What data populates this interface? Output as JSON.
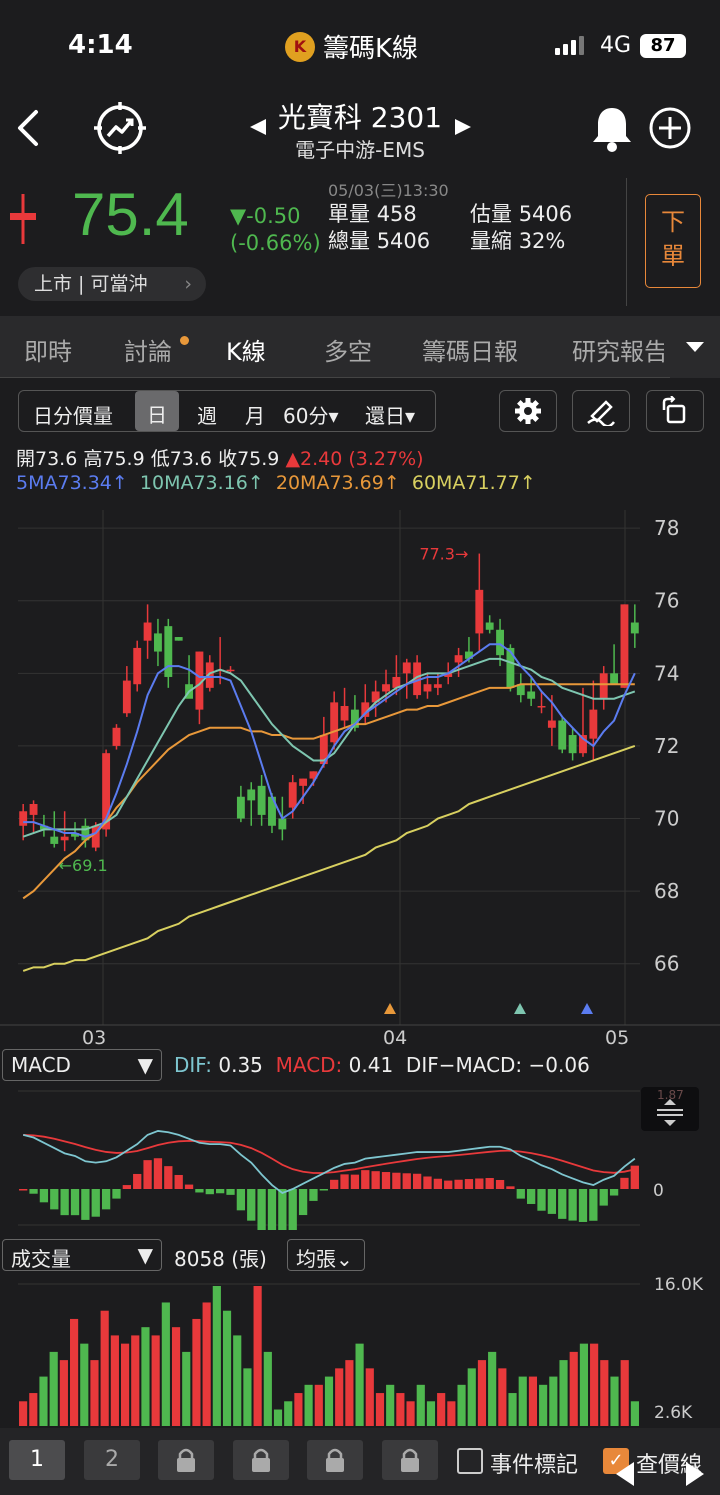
{
  "status": {
    "time": "4:14",
    "app_title": "籌碼K線",
    "network": "4G",
    "battery": "87"
  },
  "stock": {
    "name": "光寶科 2301",
    "sector": "電子中游-EMS"
  },
  "quote": {
    "price": "75.4",
    "change": "▼-0.50",
    "change_pct": "(-0.66%)",
    "datetime": "05/03(三)13:30",
    "unit_vol_label": "單量",
    "unit_vol": "458",
    "est_vol_label": "估量",
    "est_vol": "5406",
    "total_vol_label": "總量",
    "total_vol": "5406",
    "vol_ratio_label": "量縮",
    "vol_ratio": "32%",
    "market_tags": "上市 | 可當沖",
    "order_label_1": "下",
    "order_label_2": "單"
  },
  "tabs": [
    "即時",
    "討論",
    "K線",
    "多空",
    "籌碼日報",
    "研究報告"
  ],
  "toolbar": {
    "minute": "日分價量",
    "day": "日",
    "week": "週",
    "month": "月",
    "min60": "60分▾",
    "restore": "還日▾"
  },
  "ohlc": {
    "open": "開73.6",
    "high": "高75.9",
    "low": "低73.6",
    "close": "收75.9",
    "chg": "▲2.40 (3.27%)"
  },
  "ma": {
    "ma5": "5MA73.34↑",
    "ma10": "10MA73.16↑",
    "ma20": "20MA73.69↑",
    "ma60": "60MA71.77↑"
  },
  "colors": {
    "up": "#e8393b",
    "down": "#4fb84f",
    "ma5": "#5b7cf0",
    "ma10": "#7ec6b0",
    "ma20": "#e8983a",
    "ma60": "#d8d060"
  },
  "chart_data": {
    "type": "candlestick",
    "y_ticks": [
      "78",
      "76",
      "74",
      "72",
      "70",
      "68",
      "66"
    ],
    "ylim": [
      65,
      78.5
    ],
    "x_ticks": [
      "03",
      "04",
      "05"
    ],
    "annotations": {
      "high": "77.3→",
      "low": "←69.1"
    },
    "candles": [
      {
        "o": 69.8,
        "h": 70.4,
        "l": 69.4,
        "c": 70.2
      },
      {
        "o": 70.1,
        "h": 70.5,
        "l": 69.6,
        "c": 70.4
      },
      {
        "o": 69.8,
        "h": 70.1,
        "l": 69.5,
        "c": 69.7
      },
      {
        "o": 69.5,
        "h": 70.2,
        "l": 69.2,
        "c": 69.3
      },
      {
        "o": 69.4,
        "h": 70.2,
        "l": 69.1,
        "c": 69.5
      },
      {
        "o": 69.6,
        "h": 69.9,
        "l": 69.4,
        "c": 69.5
      },
      {
        "o": 69.8,
        "h": 70.0,
        "l": 69.2,
        "c": 69.4
      },
      {
        "o": 69.2,
        "h": 69.9,
        "l": 69.1,
        "c": 69.8
      },
      {
        "o": 69.7,
        "h": 71.9,
        "l": 69.5,
        "c": 71.8
      },
      {
        "o": 72.0,
        "h": 72.6,
        "l": 71.9,
        "c": 72.5
      },
      {
        "o": 72.9,
        "h": 74.2,
        "l": 72.8,
        "c": 73.8
      },
      {
        "o": 73.7,
        "h": 74.9,
        "l": 73.5,
        "c": 74.7
      },
      {
        "o": 74.9,
        "h": 75.9,
        "l": 74.4,
        "c": 75.4
      },
      {
        "o": 75.1,
        "h": 75.5,
        "l": 74.2,
        "c": 74.6
      },
      {
        "o": 75.3,
        "h": 75.5,
        "l": 73.6,
        "c": 73.9
      },
      {
        "o": 75.0,
        "h": 75.0,
        "l": 74.9,
        "c": 74.9
      },
      {
        "o": 73.7,
        "h": 74.5,
        "l": 73.5,
        "c": 73.3
      },
      {
        "o": 73.0,
        "h": 74.6,
        "l": 72.6,
        "c": 74.6
      },
      {
        "o": 73.6,
        "h": 74.5,
        "l": 73.5,
        "c": 74.3
      },
      {
        "o": 74.1,
        "h": 75.0,
        "l": 73.7,
        "c": 74.1
      },
      {
        "o": 74.1,
        "h": 74.2,
        "l": 74.0,
        "c": 74.1
      },
      {
        "o": 70.6,
        "h": 70.9,
        "l": 69.9,
        "c": 70.0
      },
      {
        "o": 70.8,
        "h": 71.0,
        "l": 69.8,
        "c": 70.5
      },
      {
        "o": 70.9,
        "h": 71.2,
        "l": 69.8,
        "c": 70.1
      },
      {
        "o": 70.6,
        "h": 70.7,
        "l": 69.6,
        "c": 69.8
      },
      {
        "o": 70.0,
        "h": 70.6,
        "l": 69.4,
        "c": 69.7
      },
      {
        "o": 70.3,
        "h": 71.2,
        "l": 70.0,
        "c": 71.0
      },
      {
        "o": 70.9,
        "h": 71.1,
        "l": 70.4,
        "c": 71.1
      },
      {
        "o": 71.1,
        "h": 71.3,
        "l": 70.9,
        "c": 71.3
      },
      {
        "o": 71.5,
        "h": 72.8,
        "l": 71.4,
        "c": 72.3
      },
      {
        "o": 72.1,
        "h": 73.5,
        "l": 71.9,
        "c": 73.2
      },
      {
        "o": 72.7,
        "h": 73.6,
        "l": 72.5,
        "c": 73.1
      },
      {
        "o": 73.0,
        "h": 73.4,
        "l": 72.4,
        "c": 72.5
      },
      {
        "o": 72.8,
        "h": 73.7,
        "l": 72.6,
        "c": 73.2
      },
      {
        "o": 73.2,
        "h": 73.8,
        "l": 72.8,
        "c": 73.5
      },
      {
        "o": 73.5,
        "h": 74.1,
        "l": 73.2,
        "c": 73.7
      },
      {
        "o": 73.6,
        "h": 74.5,
        "l": 73.4,
        "c": 73.9
      },
      {
        "o": 74.0,
        "h": 74.4,
        "l": 73.3,
        "c": 74.3
      },
      {
        "o": 73.4,
        "h": 74.5,
        "l": 73.3,
        "c": 74.3
      },
      {
        "o": 73.5,
        "h": 74.0,
        "l": 73.3,
        "c": 73.7
      },
      {
        "o": 73.6,
        "h": 74.0,
        "l": 73.4,
        "c": 73.7
      },
      {
        "o": 73.9,
        "h": 74.3,
        "l": 73.7,
        "c": 74.0
      },
      {
        "o": 74.3,
        "h": 74.7,
        "l": 73.9,
        "c": 74.5
      },
      {
        "o": 74.6,
        "h": 75.0,
        "l": 74.3,
        "c": 74.4
      },
      {
        "o": 75.1,
        "h": 77.3,
        "l": 74.6,
        "c": 76.3
      },
      {
        "o": 75.4,
        "h": 75.6,
        "l": 75.1,
        "c": 75.2
      },
      {
        "o": 75.2,
        "h": 75.5,
        "l": 74.2,
        "c": 74.5
      },
      {
        "o": 74.7,
        "h": 74.8,
        "l": 73.5,
        "c": 73.6
      },
      {
        "o": 73.7,
        "h": 74.0,
        "l": 73.2,
        "c": 73.4
      },
      {
        "o": 73.5,
        "h": 73.9,
        "l": 73.1,
        "c": 73.3
      },
      {
        "o": 73.1,
        "h": 73.5,
        "l": 72.9,
        "c": 73.1
      },
      {
        "o": 72.5,
        "h": 73.4,
        "l": 72.0,
        "c": 72.7
      },
      {
        "o": 72.7,
        "h": 72.8,
        "l": 71.8,
        "c": 71.9
      },
      {
        "o": 72.3,
        "h": 72.5,
        "l": 71.6,
        "c": 71.8
      },
      {
        "o": 71.8,
        "h": 73.6,
        "l": 71.7,
        "c": 72.3
      },
      {
        "o": 72.2,
        "h": 73.8,
        "l": 71.6,
        "c": 73.0
      },
      {
        "o": 73.3,
        "h": 74.2,
        "l": 73.0,
        "c": 74.0
      },
      {
        "o": 74.0,
        "h": 74.8,
        "l": 73.9,
        "c": 73.7
      },
      {
        "o": 73.6,
        "h": 75.9,
        "l": 73.6,
        "c": 75.9
      },
      {
        "o": 75.4,
        "h": 75.9,
        "l": 74.7,
        "c": 75.1
      }
    ],
    "ma5": [
      69.9,
      69.9,
      69.8,
      69.7,
      69.6,
      69.6,
      69.5,
      69.6,
      70.0,
      70.7,
      71.5,
      72.4,
      73.4,
      74.0,
      74.2,
      74.2,
      74.1,
      73.9,
      73.9,
      73.9,
      73.8,
      73.1,
      72.4,
      71.5,
      70.6,
      70.0,
      70.2,
      70.6,
      71.0,
      71.5,
      72.0,
      72.4,
      72.6,
      72.9,
      73.1,
      73.3,
      73.5,
      73.7,
      73.8,
      73.9,
      73.9,
      74.0,
      74.2,
      74.4,
      74.6,
      74.8,
      74.8,
      74.6,
      74.2,
      73.9,
      73.5,
      73.2,
      72.8,
      72.5,
      72.2,
      72.0,
      72.4,
      72.7,
      73.4,
      74.0
    ],
    "ma10": [
      69.5,
      69.6,
      69.7,
      69.7,
      69.7,
      69.7,
      69.7,
      69.8,
      69.9,
      70.1,
      70.6,
      71.1,
      71.6,
      72.1,
      72.6,
      73.1,
      73.5,
      73.7,
      74.0,
      74.1,
      74.0,
      73.8,
      73.4,
      73.0,
      72.6,
      72.3,
      72.0,
      71.8,
      71.6,
      71.6,
      71.8,
      72.2,
      72.6,
      72.9,
      73.2,
      73.4,
      73.6,
      73.7,
      73.9,
      74.0,
      74.0,
      74.0,
      74.1,
      74.2,
      74.3,
      74.4,
      74.4,
      74.3,
      74.2,
      74.1,
      73.9,
      73.8,
      73.6,
      73.5,
      73.4,
      73.3,
      73.3,
      73.3,
      73.4,
      73.5
    ],
    "ma20": [
      67.8,
      68.0,
      68.3,
      68.6,
      68.9,
      69.1,
      69.4,
      69.6,
      69.9,
      70.3,
      70.6,
      71.0,
      71.3,
      71.6,
      71.9,
      72.1,
      72.3,
      72.4,
      72.5,
      72.5,
      72.5,
      72.5,
      72.4,
      72.4,
      72.3,
      72.3,
      72.2,
      72.2,
      72.2,
      72.3,
      72.4,
      72.5,
      72.6,
      72.6,
      72.7,
      72.8,
      72.9,
      73.0,
      73.0,
      73.1,
      73.1,
      73.2,
      73.3,
      73.4,
      73.5,
      73.6,
      73.6,
      73.6,
      73.7,
      73.7,
      73.7,
      73.7,
      73.7,
      73.7,
      73.7,
      73.7,
      73.7,
      73.7,
      73.7,
      73.7
    ],
    "ma60": [
      65.8,
      65.9,
      65.9,
      66.0,
      66.0,
      66.1,
      66.1,
      66.2,
      66.3,
      66.4,
      66.5,
      66.6,
      66.7,
      66.9,
      67.0,
      67.1,
      67.3,
      67.4,
      67.5,
      67.6,
      67.7,
      67.8,
      67.9,
      68.0,
      68.1,
      68.2,
      68.3,
      68.4,
      68.5,
      68.6,
      68.7,
      68.8,
      68.9,
      69.0,
      69.2,
      69.3,
      69.4,
      69.6,
      69.7,
      69.8,
      70.0,
      70.1,
      70.2,
      70.4,
      70.5,
      70.6,
      70.7,
      70.8,
      70.9,
      71.0,
      71.1,
      71.2,
      71.3,
      71.4,
      71.5,
      71.6,
      71.7,
      71.8,
      71.9,
      72.0
    ]
  },
  "macd": {
    "selector": "MACD",
    "dif_label": "DIF:",
    "dif": "0.35",
    "macd_label": "MACD:",
    "macd": "0.41",
    "osc_label": "DIF−MACD:",
    "osc": "−0.06",
    "top_label": "1.87",
    "zero_label": "0"
  },
  "volume": {
    "selector": "成交量",
    "value": "8058 (張)",
    "mode": "均張⌄",
    "max_label": "16.0K",
    "min_label": "2.6K",
    "bars": [
      3,
      4,
      6,
      9,
      8,
      13,
      10,
      8,
      14,
      11,
      10,
      11,
      12,
      11,
      15,
      12,
      9,
      13,
      15,
      17,
      14,
      11,
      7,
      17,
      9,
      2,
      3,
      4,
      5,
      5,
      6,
      7,
      8,
      10,
      7,
      4,
      5,
      4,
      3,
      5,
      3,
      4,
      3,
      5,
      7,
      8,
      9,
      7,
      4,
      6,
      6,
      5,
      6,
      8,
      9,
      10,
      10,
      8,
      6,
      8,
      3
    ],
    "colors": [
      "r",
      "r",
      "g",
      "g",
      "r",
      "r",
      "g",
      "r",
      "r",
      "r",
      "r",
      "r",
      "g",
      "r",
      "g",
      "r",
      "g",
      "r",
      "r",
      "g",
      "g",
      "g",
      "g",
      "r",
      "g",
      "g",
      "g",
      "r",
      "g",
      "r",
      "g",
      "r",
      "r",
      "g",
      "r",
      "r",
      "g",
      "r",
      "r",
      "g",
      "g",
      "r",
      "r",
      "g",
      "g",
      "r",
      "g",
      "r",
      "g",
      "g",
      "r",
      "g",
      "g",
      "g",
      "r",
      "g",
      "r",
      "r",
      "g",
      "r",
      "g"
    ]
  },
  "bottom": {
    "page1": "1",
    "page2": "2",
    "event_mark": "事件標記",
    "check_price": "查價線"
  }
}
